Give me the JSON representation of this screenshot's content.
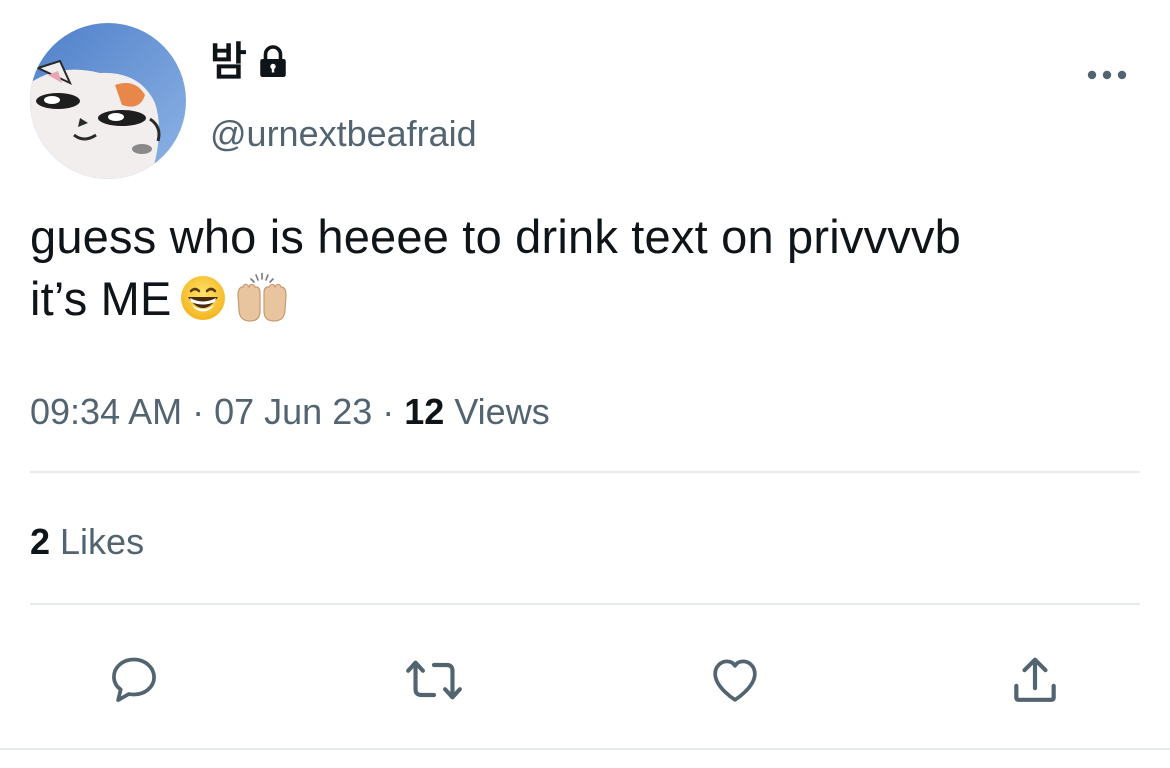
{
  "author": {
    "display_name": "밤",
    "handle": "@urnextbeafraid",
    "protected_icon": "lock-icon",
    "avatar_icon": "cartoon-cat-avatar"
  },
  "tweet": {
    "text_line1": "guess who is heeee to drink text on privvvvb",
    "text_line2": "it’s ME",
    "emojis": [
      "grinning-face-emoji",
      "raising-hands-emoji"
    ]
  },
  "meta": {
    "time": "09:34 AM",
    "separator": "·",
    "date": "07 Jun 23",
    "views_count": "12",
    "views_label": "Views"
  },
  "stats": {
    "likes_count": "2",
    "likes_label": "Likes"
  },
  "actions": [
    "reply-icon",
    "retweet-icon",
    "like-icon",
    "share-icon"
  ],
  "colors": {
    "text_primary": "#0f1419",
    "text_secondary": "#536471",
    "divider": "#e8ebed"
  }
}
